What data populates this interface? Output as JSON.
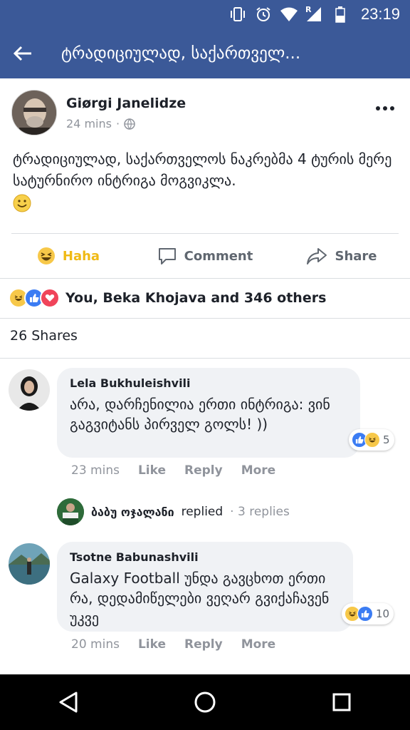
{
  "status_bar": {
    "time": "23:19",
    "icons": [
      "vibrate-icon",
      "alarm-icon",
      "wifi-icon",
      "signal-icon",
      "battery-icon"
    ],
    "roaming_label": "R"
  },
  "app_bar": {
    "title": "ტრადიციულად, საქართველ..."
  },
  "post": {
    "author": "Giørgi Janelidze",
    "time": "24 mins",
    "privacy": "·",
    "text": "ტრადიციულად, საქართველოს ნაკრებმა 4 ტურის მერე სატურნირო ინტრიგა მოგვიკლა."
  },
  "actions": {
    "haha": "Haha",
    "comment": "Comment",
    "share": "Share"
  },
  "reactions": {
    "summary": "You, Beka Khojava and 346 others"
  },
  "shares": {
    "label": "26 Shares"
  },
  "comments": [
    {
      "name": "Lela Bukhuleishvili",
      "text": "არა, დარჩენილია ერთი ინტრიგა: ვინ გაგვიტანს პირველ გოლს! ))",
      "reaction_count": "5",
      "time": "23 mins",
      "like": "Like",
      "reply": "Reply",
      "more": "More"
    },
    {
      "name": "Tsotne Babunashvili",
      "text": "Galaxy Football უნდა გავცხოთ ერთი რა, დედამიწელები ვეღარ გვიქაჩავენ უკვე",
      "reaction_count": "10",
      "time": "20 mins",
      "like": "Like",
      "reply": "Reply",
      "more": "More"
    }
  ],
  "reply_summary": {
    "name": "ბაბუ ოჯალანი",
    "action": "replied",
    "count": "· 3 replies"
  },
  "colors": {
    "brand": "#3b5998",
    "haha": "#f0ba15",
    "like": "#3b7cf3",
    "love": "#f0445a"
  }
}
